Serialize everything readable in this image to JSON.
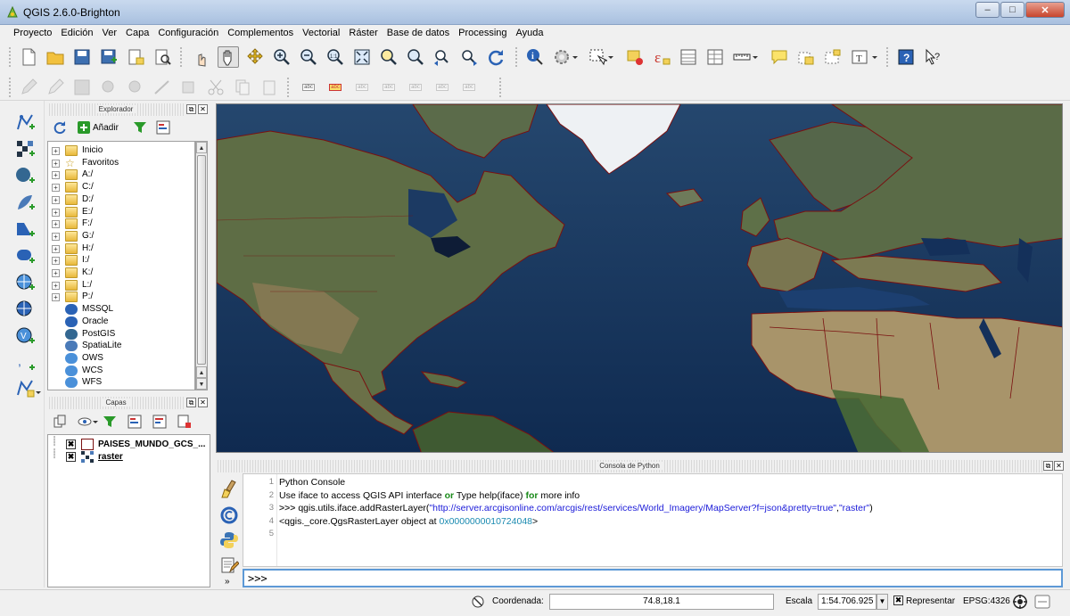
{
  "window": {
    "title": "QGIS 2.6.0-Brighton",
    "minimize": "‒",
    "maximize": "□",
    "close": "✕"
  },
  "menu": [
    "Proyecto",
    "Edición",
    "Ver",
    "Capa",
    "Configuración",
    "Complementos",
    "Vectorial",
    "Ráster",
    "Base de datos",
    "Processing",
    "Ayuda"
  ],
  "explorer": {
    "title": "Explorador",
    "add_label": "Añadir",
    "items": [
      {
        "label": "Inicio",
        "icon": "folder-icon"
      },
      {
        "label": "Favoritos",
        "icon": "star-icon"
      },
      {
        "label": "A:/",
        "icon": "folder-icon"
      },
      {
        "label": "C:/",
        "icon": "folder-icon"
      },
      {
        "label": "D:/",
        "icon": "folder-icon"
      },
      {
        "label": "E:/",
        "icon": "folder-icon"
      },
      {
        "label": "F:/",
        "icon": "folder-icon"
      },
      {
        "label": "G:/",
        "icon": "folder-icon"
      },
      {
        "label": "H:/",
        "icon": "folder-icon"
      },
      {
        "label": "I:/",
        "icon": "folder-icon"
      },
      {
        "label": "K:/",
        "icon": "folder-icon"
      },
      {
        "label": "L:/",
        "icon": "folder-icon"
      },
      {
        "label": "P:/",
        "icon": "folder-icon"
      },
      {
        "label": "MSSQL",
        "icon": "mssql-icon"
      },
      {
        "label": "Oracle",
        "icon": "oracle-icon"
      },
      {
        "label": "PostGIS",
        "icon": "postgis-icon"
      },
      {
        "label": "SpatiaLite",
        "icon": "spatialite-icon"
      },
      {
        "label": "OWS",
        "icon": "ows-icon"
      },
      {
        "label": "WCS",
        "icon": "wcs-icon"
      },
      {
        "label": "WFS",
        "icon": "wfs-icon"
      }
    ]
  },
  "layers": {
    "title": "Capas",
    "items": [
      {
        "label": "PAISES_MUNDO_GCS_...",
        "checked": "✖"
      },
      {
        "label": "raster",
        "checked": "✖"
      }
    ]
  },
  "console": {
    "title": "Consola de Python",
    "lines": [
      {
        "n": "1",
        "parts": [
          {
            "t": "Python Console",
            "c": ""
          }
        ]
      },
      {
        "n": "2",
        "parts": [
          {
            "t": "Use iface to access QGIS API interface ",
            "c": ""
          },
          {
            "t": "or",
            "c": "kw"
          },
          {
            "t": " Type help(iface) ",
            "c": ""
          },
          {
            "t": "for",
            "c": "kw"
          },
          {
            "t": " more info",
            "c": ""
          }
        ]
      },
      {
        "n": "3",
        "parts": [
          {
            "t": ">>> ",
            "c": "prompt"
          },
          {
            "t": "qgis.utils.iface.addRasterLayer(",
            "c": ""
          },
          {
            "t": "\"http://server.arcgisonline.com/arcgis/rest/services/World_Imagery/MapServer?f=json&pretty=true\"",
            "c": "str"
          },
          {
            "t": ",",
            "c": ""
          },
          {
            "t": "\"raster\"",
            "c": "str"
          },
          {
            "t": ")",
            "c": ""
          }
        ]
      },
      {
        "n": "4",
        "parts": [
          {
            "t": "<qgis._core.QgsRasterLayer object at ",
            "c": ""
          },
          {
            "t": "0x0000000010724048",
            "c": "num"
          },
          {
            "t": ">",
            "c": ""
          }
        ]
      },
      {
        "n": "5",
        "parts": []
      }
    ],
    "input_prompt": ">>>"
  },
  "status": {
    "coord_label": "Coordenada:",
    "coord_value": "74.8,18.1",
    "scale_label": "Escala",
    "scale_value": "1:54.706.925",
    "render_label": "Representar",
    "render_checked": "✖",
    "crs": "EPSG:4326"
  },
  "colors": {
    "ocean": "#14335c",
    "border": "#7a1010",
    "accent": "#5d99d6"
  }
}
